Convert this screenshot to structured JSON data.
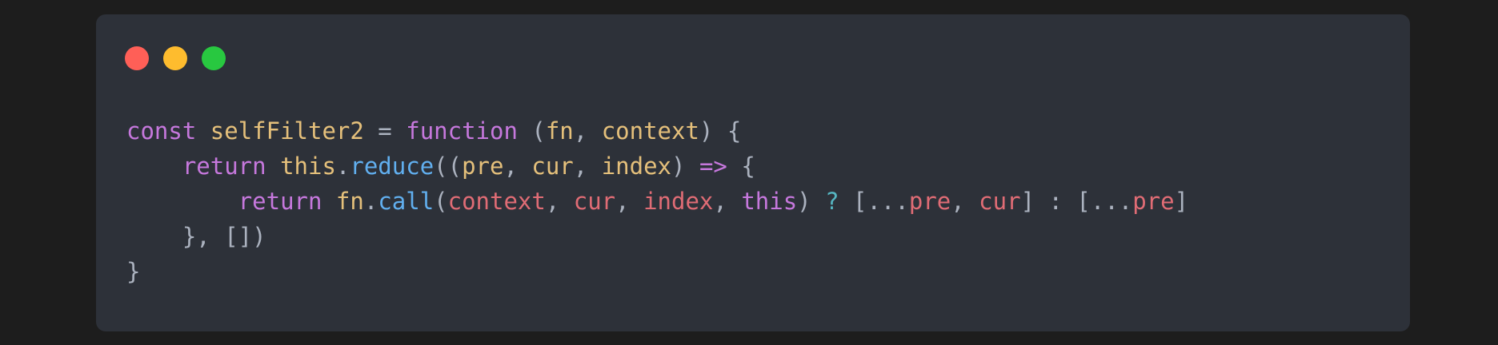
{
  "window": {
    "background": "#2d3139",
    "dots": [
      {
        "name": "close",
        "color": "#ff5f57"
      },
      {
        "name": "minimize",
        "color": "#febc2e"
      },
      {
        "name": "zoom",
        "color": "#28c840"
      }
    ]
  },
  "colors": {
    "keyword": "#c678dd",
    "function": "#e5c07b",
    "method": "#61afef",
    "variable": "#e06c75",
    "operator": "#56b6c2",
    "punct": "#abb2bf"
  },
  "code": {
    "lines": [
      {
        "tokens": [
          {
            "text": "const",
            "kind": "keyword"
          },
          {
            "text": " ",
            "kind": "punct"
          },
          {
            "text": "selfFilter2",
            "kind": "function"
          },
          {
            "text": " = ",
            "kind": "punct"
          },
          {
            "text": "function",
            "kind": "keyword"
          },
          {
            "text": " (",
            "kind": "punct"
          },
          {
            "text": "fn",
            "kind": "function"
          },
          {
            "text": ", ",
            "kind": "punct"
          },
          {
            "text": "context",
            "kind": "function"
          },
          {
            "text": ") {",
            "kind": "punct"
          }
        ]
      },
      {
        "tokens": [
          {
            "text": "    ",
            "kind": "punct"
          },
          {
            "text": "return",
            "kind": "keyword"
          },
          {
            "text": " ",
            "kind": "punct"
          },
          {
            "text": "this",
            "kind": "function"
          },
          {
            "text": ".",
            "kind": "punct"
          },
          {
            "text": "reduce",
            "kind": "method"
          },
          {
            "text": "((",
            "kind": "punct"
          },
          {
            "text": "pre",
            "kind": "function"
          },
          {
            "text": ", ",
            "kind": "punct"
          },
          {
            "text": "cur",
            "kind": "function"
          },
          {
            "text": ", ",
            "kind": "punct"
          },
          {
            "text": "index",
            "kind": "function"
          },
          {
            "text": ") ",
            "kind": "punct"
          },
          {
            "text": "=>",
            "kind": "keyword"
          },
          {
            "text": " {",
            "kind": "punct"
          }
        ]
      },
      {
        "tokens": [
          {
            "text": "        ",
            "kind": "punct"
          },
          {
            "text": "return",
            "kind": "keyword"
          },
          {
            "text": " ",
            "kind": "punct"
          },
          {
            "text": "fn",
            "kind": "function"
          },
          {
            "text": ".",
            "kind": "punct"
          },
          {
            "text": "call",
            "kind": "method"
          },
          {
            "text": "(",
            "kind": "punct"
          },
          {
            "text": "context",
            "kind": "variable"
          },
          {
            "text": ", ",
            "kind": "punct"
          },
          {
            "text": "cur",
            "kind": "variable"
          },
          {
            "text": ", ",
            "kind": "punct"
          },
          {
            "text": "index",
            "kind": "variable"
          },
          {
            "text": ", ",
            "kind": "punct"
          },
          {
            "text": "this",
            "kind": "keyword"
          },
          {
            "text": ") ",
            "kind": "punct"
          },
          {
            "text": "?",
            "kind": "operator"
          },
          {
            "text": " [",
            "kind": "punct"
          },
          {
            "text": "...",
            "kind": "punct"
          },
          {
            "text": "pre",
            "kind": "variable"
          },
          {
            "text": ", ",
            "kind": "punct"
          },
          {
            "text": "cur",
            "kind": "variable"
          },
          {
            "text": "] : [",
            "kind": "punct"
          },
          {
            "text": "...",
            "kind": "punct"
          },
          {
            "text": "pre",
            "kind": "variable"
          },
          {
            "text": "]",
            "kind": "punct"
          }
        ]
      },
      {
        "tokens": [
          {
            "text": "    }, [])",
            "kind": "punct"
          }
        ]
      },
      {
        "tokens": [
          {
            "text": "}",
            "kind": "punct"
          }
        ]
      }
    ]
  }
}
